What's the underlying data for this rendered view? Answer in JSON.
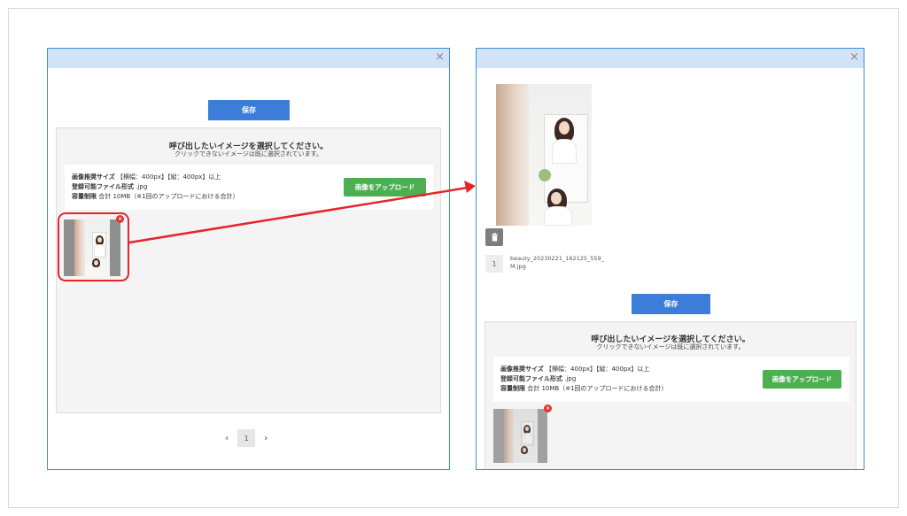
{
  "left_modal": {
    "save_label": "保存",
    "title": "呼び出したいイメージを選択してください。",
    "subtitle": "クリックできないイメージは既に選択されています。",
    "info": {
      "size_label": "画像推奨サイズ",
      "size_value": "【横幅：400px】【縦：400px】以上",
      "format_label": "登録可能ファイル形式",
      "format_value": ".jpg",
      "limit_label": "容量制限",
      "limit_value": "合計 10MB（※1回のアップロードにおける合計）"
    },
    "upload_label": "画像をアップロード",
    "pager": {
      "prev": "‹",
      "page": "1",
      "next": "›"
    }
  },
  "right_modal": {
    "file_index": "1",
    "file_name_line1": "beauty_20230221_162125_559_",
    "file_name_line2": "M.jpg",
    "save_label": "保存",
    "title": "呼び出したいイメージを選択してください。",
    "subtitle": "クリックできないイメージは既に選択されています。",
    "info": {
      "size_label": "画像推奨サイズ",
      "size_value": "【横幅：400px】【縦：400px】以上",
      "format_label": "登録可能ファイル形式",
      "format_value": ".jpg",
      "limit_label": "容量制限",
      "limit_value": "合計 10MB（※1回のアップロードにおける合計）"
    },
    "upload_label": "画像をアップロード"
  },
  "icons": {
    "close": "×",
    "remove": "×",
    "trash": "trash-icon"
  },
  "colors": {
    "modal_border": "#3d8ed6",
    "header": "#d3e3f7",
    "primary": "#3b7dd8",
    "upload": "#4caf50",
    "highlight": "#e5252a"
  }
}
